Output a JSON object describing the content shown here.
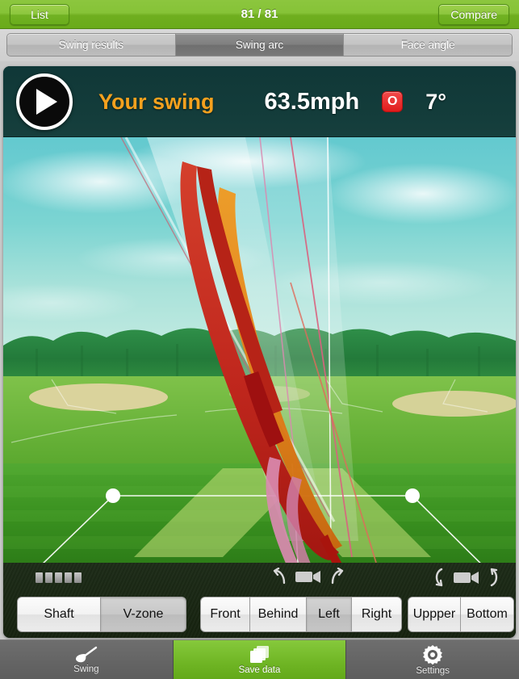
{
  "topbar": {
    "list_label": "List",
    "title": "81 / 81",
    "compare_label": "Compare"
  },
  "tabs": [
    {
      "label": "Swing results",
      "selected": false
    },
    {
      "label": "Swing arc",
      "selected": true
    },
    {
      "label": "Face angle",
      "selected": false
    }
  ],
  "viewer": {
    "play_icon": "play-icon",
    "swing_label": "Your swing",
    "speed": "63.5mph",
    "badge": "O",
    "angle": "7°",
    "badge_color": "#e01b1b",
    "label_color": "#f5a11e"
  },
  "scene": {
    "arc_colors": {
      "downswing_red": "#c0271d",
      "backswing_orange": "#e07c16",
      "dark_red": "#9e1010",
      "pink_trace": "#d98ab0",
      "plane_fill": "#e8f3f0",
      "vzone_fill": "#b6d66a"
    },
    "ball_markers": 2
  },
  "tray": {
    "level_bars": 5,
    "camera_controls": [
      {
        "name": "camera-rotate-horizontal",
        "left_icon": "rotate-left-icon",
        "center_icon": "video-camera-icon",
        "right_icon": "rotate-right-icon"
      },
      {
        "name": "camera-rotate-vertical",
        "left_icon": "rotate-up-icon",
        "center_icon": "video-camera-icon",
        "right_icon": "rotate-down-icon"
      }
    ],
    "overlay_buttons": [
      {
        "label": "Shaft",
        "selected": false
      },
      {
        "label": "V-zone",
        "selected": true
      }
    ],
    "view_buttons": [
      {
        "label": "Front",
        "selected": false
      },
      {
        "label": "Behind",
        "selected": false
      },
      {
        "label": "Left",
        "selected": true
      },
      {
        "label": "Right",
        "selected": false
      }
    ],
    "height_buttons": [
      {
        "label": "Uppper",
        "selected": false
      },
      {
        "label": "Bottom",
        "selected": false
      }
    ]
  },
  "tabbar": [
    {
      "label": "Swing",
      "icon": "golf-club-icon",
      "selected": false
    },
    {
      "label": "Save data",
      "icon": "stacked-pages-icon",
      "selected": true
    },
    {
      "label": "Settings",
      "icon": "gear-icon",
      "selected": false
    }
  ]
}
